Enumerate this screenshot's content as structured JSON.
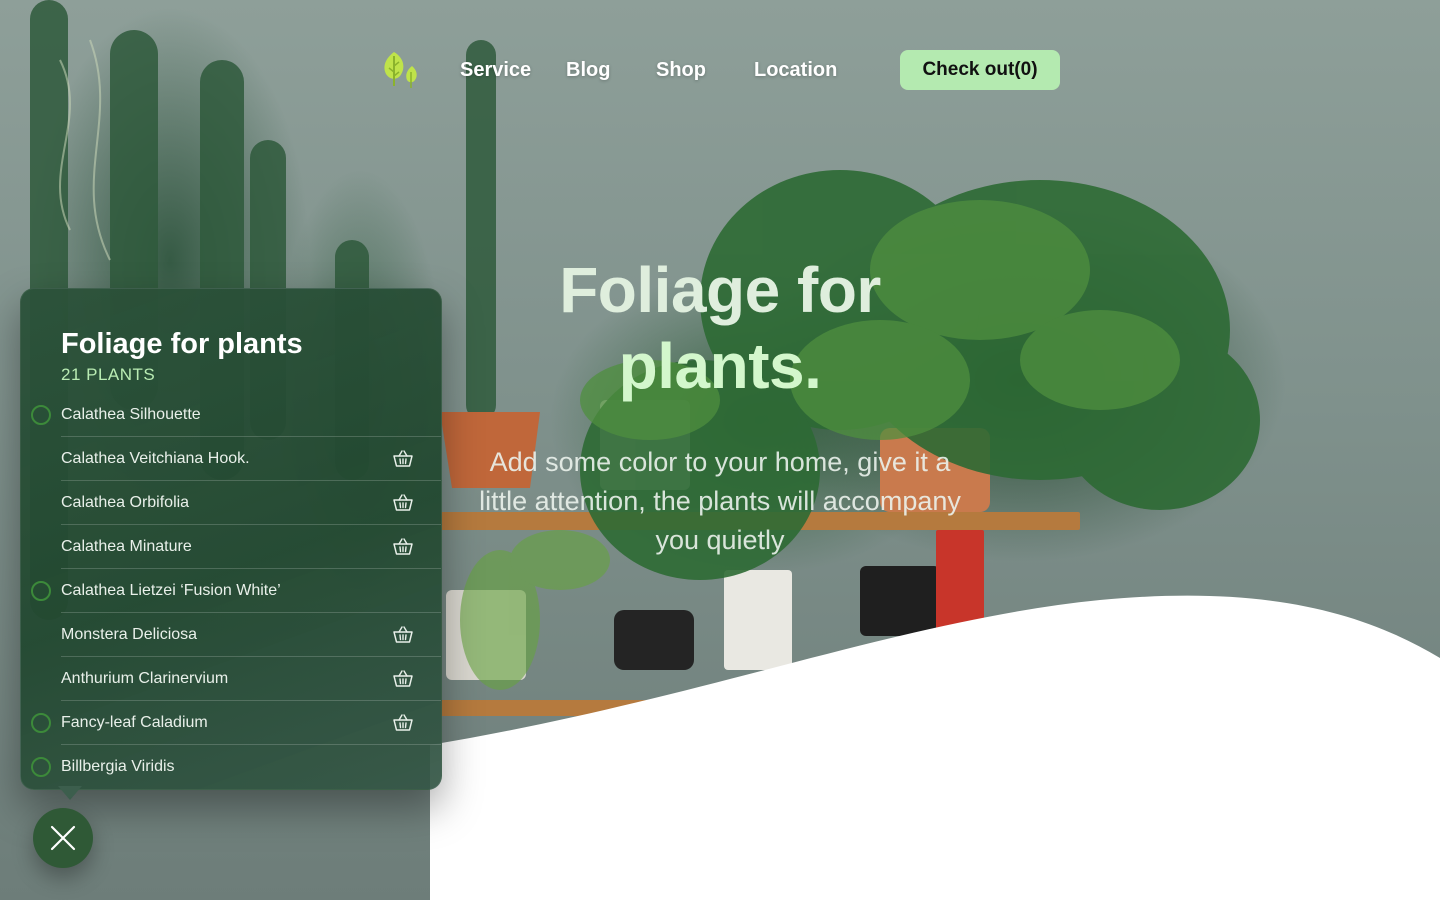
{
  "nav": {
    "logo_icon": "leaf-trees-icon",
    "links": [
      "Service",
      "Blog",
      "Shop",
      "Location"
    ],
    "checkout_label": "Check out(0)"
  },
  "hero": {
    "title_line1": "Foliage for",
    "title_line2": "plants.",
    "subtitle": "Add some color to your home, give it a little attention, the plants will accompany you quietly"
  },
  "panel": {
    "title": "Foliage for plants",
    "count": "21 PLANTS",
    "items": [
      {
        "name": "Calathea Silhouette",
        "ring": true,
        "basket": false
      },
      {
        "name": "Calathea Veitchiana Hook.",
        "ring": false,
        "basket": true
      },
      {
        "name": "Calathea Orbifolia",
        "ring": false,
        "basket": true
      },
      {
        "name": "Calathea Minature",
        "ring": false,
        "basket": true
      },
      {
        "name": "Calathea Lietzei ‘Fusion White’",
        "ring": true,
        "basket": false
      },
      {
        "name": "Monstera Deliciosa",
        "ring": false,
        "basket": true
      },
      {
        "name": "Anthurium Clarinervium",
        "ring": false,
        "basket": true
      },
      {
        "name": "Fancy-leaf Caladium",
        "ring": true,
        "basket": true
      },
      {
        "name": "Billbergia Viridis",
        "ring": true,
        "basket": false
      }
    ],
    "close_icon": "close-icon"
  },
  "colors": {
    "accent": "#b4eab0",
    "panel": "#2c523a",
    "ring": "#3c8a3a",
    "close_button": "#2f5936"
  }
}
